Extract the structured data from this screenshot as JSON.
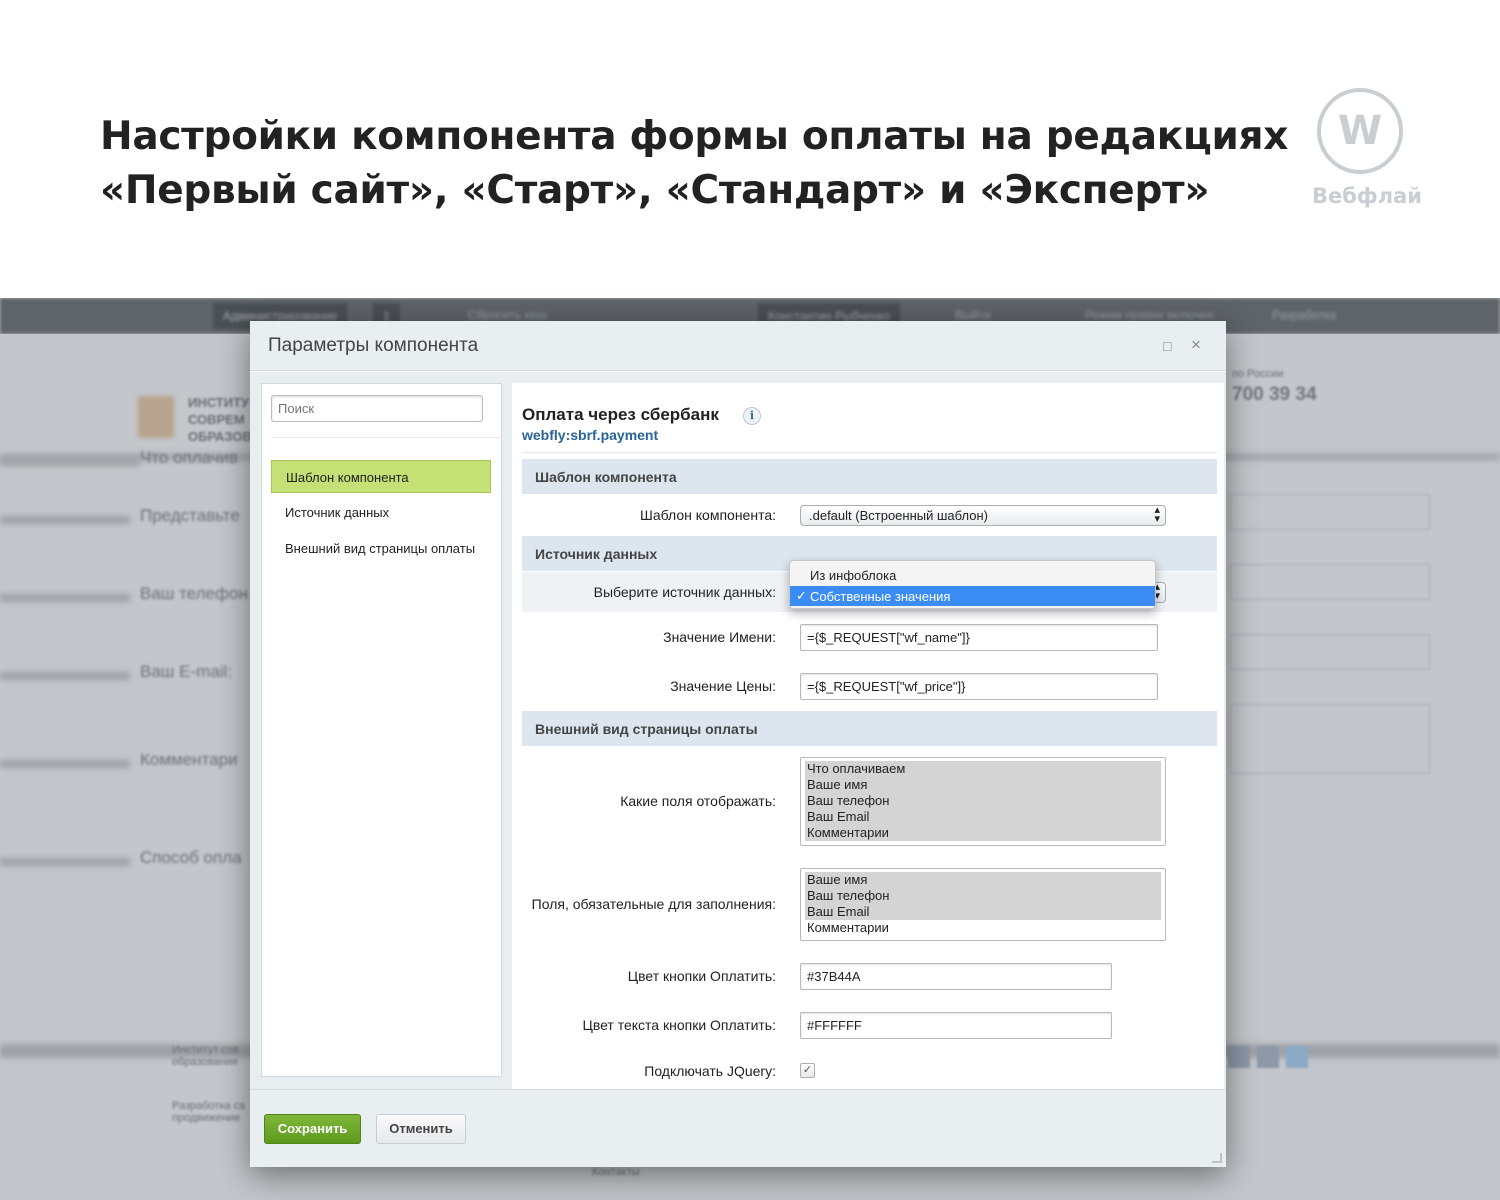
{
  "slide": {
    "title_line1": "Настройки компонента формы оплаты на редакциях",
    "title_line2": "«Первый сайт», «Старт», «Стандарт» и «Эксперт»",
    "brand_letter": "W",
    "brand_name": "Вебфлай"
  },
  "background": {
    "topbar": [
      "Администрирование",
      "1",
      "Сбросить кеш",
      "Константин Рыбченко",
      "Выйти",
      "Режим правки включен",
      "Разработка"
    ],
    "left_labels": [
      "Что оплачив",
      "Представьте",
      "Ваш телефон",
      "Ваш E-mail:",
      "Комментари",
      "Способ опла"
    ],
    "logo_lines": [
      "ИНСТИТУ",
      "СОВРЕМ",
      "ОБРАЗОВ"
    ],
    "region": "по России",
    "phone": "700 39 34",
    "footer_org": [
      "Институт сов",
      "образования"
    ],
    "footer_dev": [
      "Разработка са",
      "продвижение"
    ],
    "footer_misc": "Контакты"
  },
  "dialog": {
    "title": "Параметры компонента",
    "controls": {
      "maximize": "□",
      "close": "×"
    },
    "search_placeholder": "Поиск",
    "sidebar": [
      {
        "label": "Шаблон компонента",
        "active": true
      },
      {
        "label": "Источник данных",
        "active": false
      },
      {
        "label": "Внешний вид страницы оплаты",
        "active": false
      }
    ],
    "component": {
      "name": "Оплата через сбербанк",
      "code": "webfly:sbrf.payment",
      "info_icon": "i"
    },
    "sections": {
      "template": "Шаблон компонента",
      "source": "Источник данных",
      "appearance": "Внешний вид страницы оплаты"
    },
    "fields": {
      "template_label": "Шаблон компонента:",
      "template_value": ".default (Встроенный шаблон)",
      "source_label": "Выберите источник данных:",
      "source_options": [
        "Из инфоблока",
        "Собственные значения"
      ],
      "source_selected_mark": "✓",
      "name_label": "Значение Имени:",
      "name_value": "={$_REQUEST[\"wf_name\"]}",
      "price_label": "Значение Цены:",
      "price_value": "={$_REQUEST[\"wf_price\"]}",
      "show_fields_label": "Какие поля отображать:",
      "show_fields_options": [
        "Что оплачиваем",
        "Ваше имя",
        "Ваш телефон",
        "Ваш Email",
        "Комментарии"
      ],
      "required_label": "Поля, обязательные для заполнения:",
      "required_options": [
        "Ваше имя",
        "Ваш телефон",
        "Ваш Email",
        "Комментарии"
      ],
      "btn_color_label": "Цвет кнопки Оплатить:",
      "btn_color_value": "#37B44A",
      "btn_text_color_label": "Цвет текста кнопки Оплатить:",
      "btn_text_color_value": "#FFFFFF",
      "jquery_label": "Подключать JQuery:",
      "jquery_checked": true
    },
    "buttons": {
      "save": "Сохранить",
      "cancel": "Отменить"
    }
  },
  "colors": {
    "accent_green": "#5c9a1e",
    "active_item": "#c5e075",
    "link_blue": "#2a6496",
    "highlight_blue": "#3b8cf5"
  }
}
